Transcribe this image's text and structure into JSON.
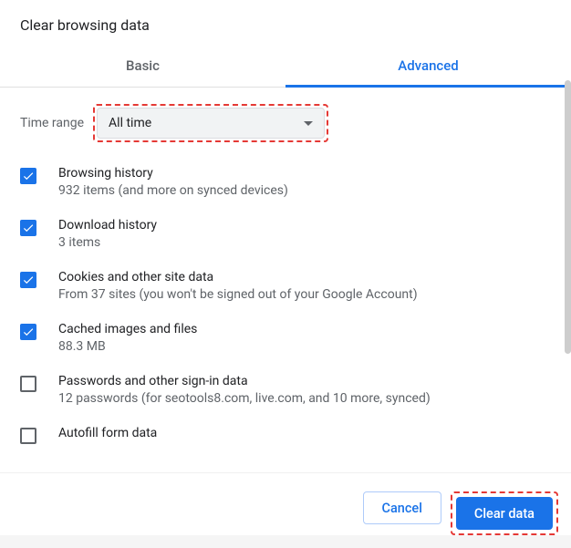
{
  "dialog": {
    "title": "Clear browsing data"
  },
  "tabs": {
    "basic": "Basic",
    "advanced": "Advanced"
  },
  "time_range": {
    "label": "Time range",
    "value": "All time"
  },
  "options": [
    {
      "title": "Browsing history",
      "sub": "932 items (and more on synced devices)",
      "checked": true
    },
    {
      "title": "Download history",
      "sub": "3 items",
      "checked": true
    },
    {
      "title": "Cookies and other site data",
      "sub": "From 37 sites (you won't be signed out of your Google Account)",
      "checked": true
    },
    {
      "title": "Cached images and files",
      "sub": "88.3 MB",
      "checked": true
    },
    {
      "title": "Passwords and other sign-in data",
      "sub": "12 passwords (for seotools8.com, live.com, and 10 more, synced)",
      "checked": false
    },
    {
      "title": "Autofill form data",
      "sub": "",
      "checked": false
    }
  ],
  "footer": {
    "cancel": "Cancel",
    "clear": "Clear data"
  }
}
